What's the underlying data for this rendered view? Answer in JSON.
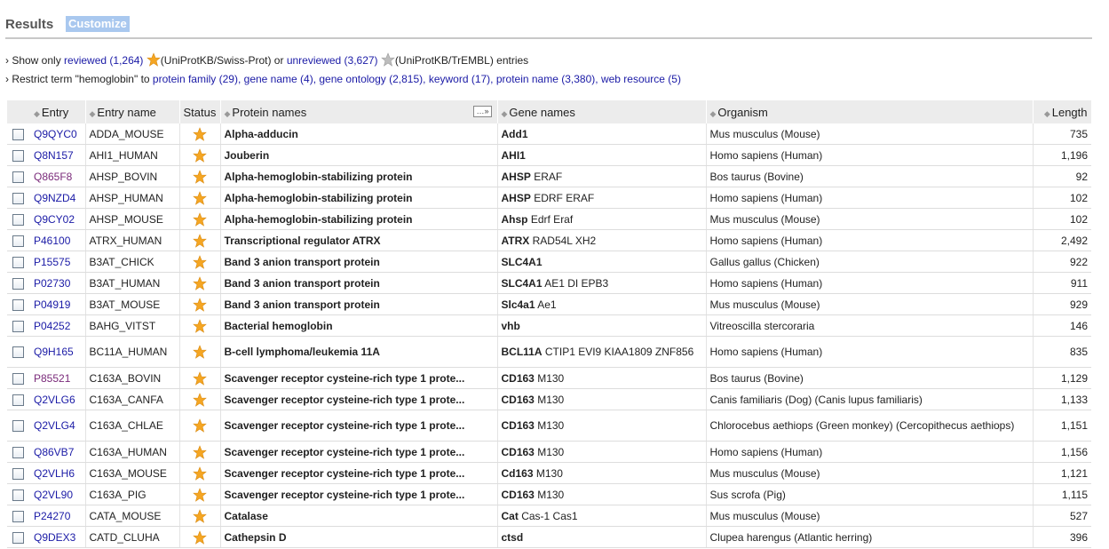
{
  "header": {
    "title": "Results",
    "customize": "Customize"
  },
  "filters": {
    "line1": {
      "prefix": "› Show only",
      "reviewed": "reviewed (1,264)",
      "reviewed_desc": "(UniProtKB/Swiss-Prot) or",
      "unreviewed": "unreviewed (3,627)",
      "unreviewed_desc": "(UniProtKB/TrEMBL) entries"
    },
    "line2": {
      "prefix": "› Restrict term \"hemoglobin\" to",
      "links": [
        "protein family (29),",
        "gene name (4),",
        "gene ontology (2,815),",
        "keyword (17),",
        "protein name (3,380),",
        "web resource (5)"
      ]
    }
  },
  "colors": {
    "link": "#1a1aa6",
    "visited": "#7a2a7a",
    "star": "#f5a623",
    "customize_bg": "#a9c8ef"
  },
  "table": {
    "headers": {
      "entry": "Entry",
      "entry_name": "Entry name",
      "status": "Status",
      "protein_names": "Protein names",
      "gene_names": "Gene names",
      "organism": "Organism",
      "length": "Length"
    },
    "rows": [
      {
        "entry": "Q9QYC0",
        "name": "ADDA_MOUSE",
        "protein": "Alpha-adducin",
        "gene_main": "Add1",
        "gene_rest": "",
        "organism": "Mus musculus (Mouse)",
        "length": "735"
      },
      {
        "entry": "Q8N157",
        "name": "AHI1_HUMAN",
        "protein": "Jouberin",
        "gene_main": "AHI1",
        "gene_rest": "",
        "organism": "Homo sapiens (Human)",
        "length": "1,196"
      },
      {
        "entry": "Q865F8",
        "name": "AHSP_BOVIN",
        "protein": "Alpha-hemoglobin-stabilizing protein",
        "gene_main": "AHSP",
        "gene_rest": "ERAF",
        "organism": "Bos taurus (Bovine)",
        "length": "92"
      },
      {
        "entry": "Q9NZD4",
        "name": "AHSP_HUMAN",
        "protein": "Alpha-hemoglobin-stabilizing protein",
        "gene_main": "AHSP",
        "gene_rest": "EDRF ERAF",
        "organism": "Homo sapiens (Human)",
        "length": "102"
      },
      {
        "entry": "Q9CY02",
        "name": "AHSP_MOUSE",
        "protein": "Alpha-hemoglobin-stabilizing protein",
        "gene_main": "Ahsp",
        "gene_rest": "Edrf Eraf",
        "organism": "Mus musculus (Mouse)",
        "length": "102"
      },
      {
        "entry": "P46100",
        "name": "ATRX_HUMAN",
        "protein": "Transcriptional regulator ATRX",
        "gene_main": "ATRX",
        "gene_rest": "RAD54L XH2",
        "organism": "Homo sapiens (Human)",
        "length": "2,492"
      },
      {
        "entry": "P15575",
        "name": "B3AT_CHICK",
        "protein": "Band 3 anion transport protein",
        "gene_main": "SLC4A1",
        "gene_rest": "",
        "organism": "Gallus gallus (Chicken)",
        "length": "922"
      },
      {
        "entry": "P02730",
        "name": "B3AT_HUMAN",
        "protein": "Band 3 anion transport protein",
        "gene_main": "SLC4A1",
        "gene_rest": "AE1 DI EPB3",
        "organism": "Homo sapiens (Human)",
        "length": "911"
      },
      {
        "entry": "P04919",
        "name": "B3AT_MOUSE",
        "protein": "Band 3 anion transport protein",
        "gene_main": "Slc4a1",
        "gene_rest": "Ae1",
        "organism": "Mus musculus (Mouse)",
        "length": "929"
      },
      {
        "entry": "P04252",
        "name": "BAHG_VITST",
        "protein": "Bacterial hemoglobin",
        "gene_main": "vhb",
        "gene_rest": "",
        "organism": "Vitreoscilla stercoraria",
        "length": "146"
      },
      {
        "entry": "Q9H165",
        "name": "BC11A_HUMAN",
        "protein": "B-cell lymphoma/leukemia 11A",
        "gene_main": "BCL11A",
        "gene_rest": "CTIP1 EVI9 KIAA1809 ZNF856",
        "organism": "Homo sapiens (Human)",
        "length": "835"
      },
      {
        "entry": "P85521",
        "name": "C163A_BOVIN",
        "protein": "Scavenger receptor cysteine-rich type 1 prote...",
        "gene_main": "CD163",
        "gene_rest": "M130",
        "organism": "Bos taurus (Bovine)",
        "length": "1,129"
      },
      {
        "entry": "Q2VLG6",
        "name": "C163A_CANFA",
        "protein": "Scavenger receptor cysteine-rich type 1 prote...",
        "gene_main": "CD163",
        "gene_rest": "M130",
        "organism": "Canis familiaris (Dog) (Canis lupus familiaris)",
        "length": "1,133"
      },
      {
        "entry": "Q2VLG4",
        "name": "C163A_CHLAE",
        "protein": "Scavenger receptor cysteine-rich type 1 prote...",
        "gene_main": "CD163",
        "gene_rest": "M130",
        "organism": "Chlorocebus aethiops (Green monkey) (Cercopithecus aethiops)",
        "length": "1,151"
      },
      {
        "entry": "Q86VB7",
        "name": "C163A_HUMAN",
        "protein": "Scavenger receptor cysteine-rich type 1 prote...",
        "gene_main": "CD163",
        "gene_rest": "M130",
        "organism": "Homo sapiens (Human)",
        "length": "1,156"
      },
      {
        "entry": "Q2VLH6",
        "name": "C163A_MOUSE",
        "protein": "Scavenger receptor cysteine-rich type 1 prote...",
        "gene_main": "Cd163",
        "gene_rest": "M130",
        "organism": "Mus musculus (Mouse)",
        "length": "1,121"
      },
      {
        "entry": "Q2VL90",
        "name": "C163A_PIG",
        "protein": "Scavenger receptor cysteine-rich type 1 prote...",
        "gene_main": "CD163",
        "gene_rest": "M130",
        "organism": "Sus scrofa (Pig)",
        "length": "1,115"
      },
      {
        "entry": "P24270",
        "name": "CATA_MOUSE",
        "protein": "Catalase",
        "gene_main": "Cat",
        "gene_rest": "Cas-1 Cas1",
        "organism": "Mus musculus (Mouse)",
        "length": "527"
      },
      {
        "entry": "Q9DEX3",
        "name": "CATD_CLUHA",
        "protein": "Cathepsin D",
        "gene_main": "ctsd",
        "gene_rest": "",
        "organism": "Clupea harengus (Atlantic herring)",
        "length": "396"
      }
    ]
  }
}
